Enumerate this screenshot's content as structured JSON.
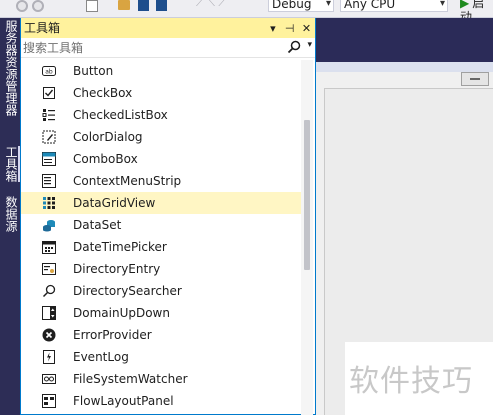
{
  "toolbar": {
    "config_value": "Debug",
    "platform_value": "Any CPU",
    "start_label": "启动"
  },
  "side_tabs": [
    "服务器资源管理器",
    "工具箱",
    "数据源"
  ],
  "toolbox": {
    "title": "工具箱",
    "search_placeholder": "搜索工具箱",
    "items": [
      {
        "label": "Button",
        "icon": "button-icon"
      },
      {
        "label": "CheckBox",
        "icon": "checkbox-icon"
      },
      {
        "label": "CheckedListBox",
        "icon": "checkedlistbox-icon"
      },
      {
        "label": "ColorDialog",
        "icon": "colordialog-icon"
      },
      {
        "label": "ComboBox",
        "icon": "combobox-icon"
      },
      {
        "label": "ContextMenuStrip",
        "icon": "contextmenustrip-icon"
      },
      {
        "label": "DataGridView",
        "icon": "datagridview-icon",
        "selected": true
      },
      {
        "label": "DataSet",
        "icon": "dataset-icon"
      },
      {
        "label": "DateTimePicker",
        "icon": "datetimepicker-icon"
      },
      {
        "label": "DirectoryEntry",
        "icon": "directoryentry-icon"
      },
      {
        "label": "DirectorySearcher",
        "icon": "directorysearcher-icon"
      },
      {
        "label": "DomainUpDown",
        "icon": "domainupdown-icon"
      },
      {
        "label": "ErrorProvider",
        "icon": "errorprovider-icon"
      },
      {
        "label": "EventLog",
        "icon": "eventlog-icon"
      },
      {
        "label": "FileSystemWatcher",
        "icon": "filesystemwatcher-icon"
      },
      {
        "label": "FlowLayoutPanel",
        "icon": "flowlayoutpanel-icon"
      }
    ]
  },
  "watermark": "软件技巧",
  "colors": {
    "side_strip": "#2d2d56",
    "title_active": "#fff29d",
    "selected_row": "#fff6c4",
    "accent": "#007acc"
  }
}
